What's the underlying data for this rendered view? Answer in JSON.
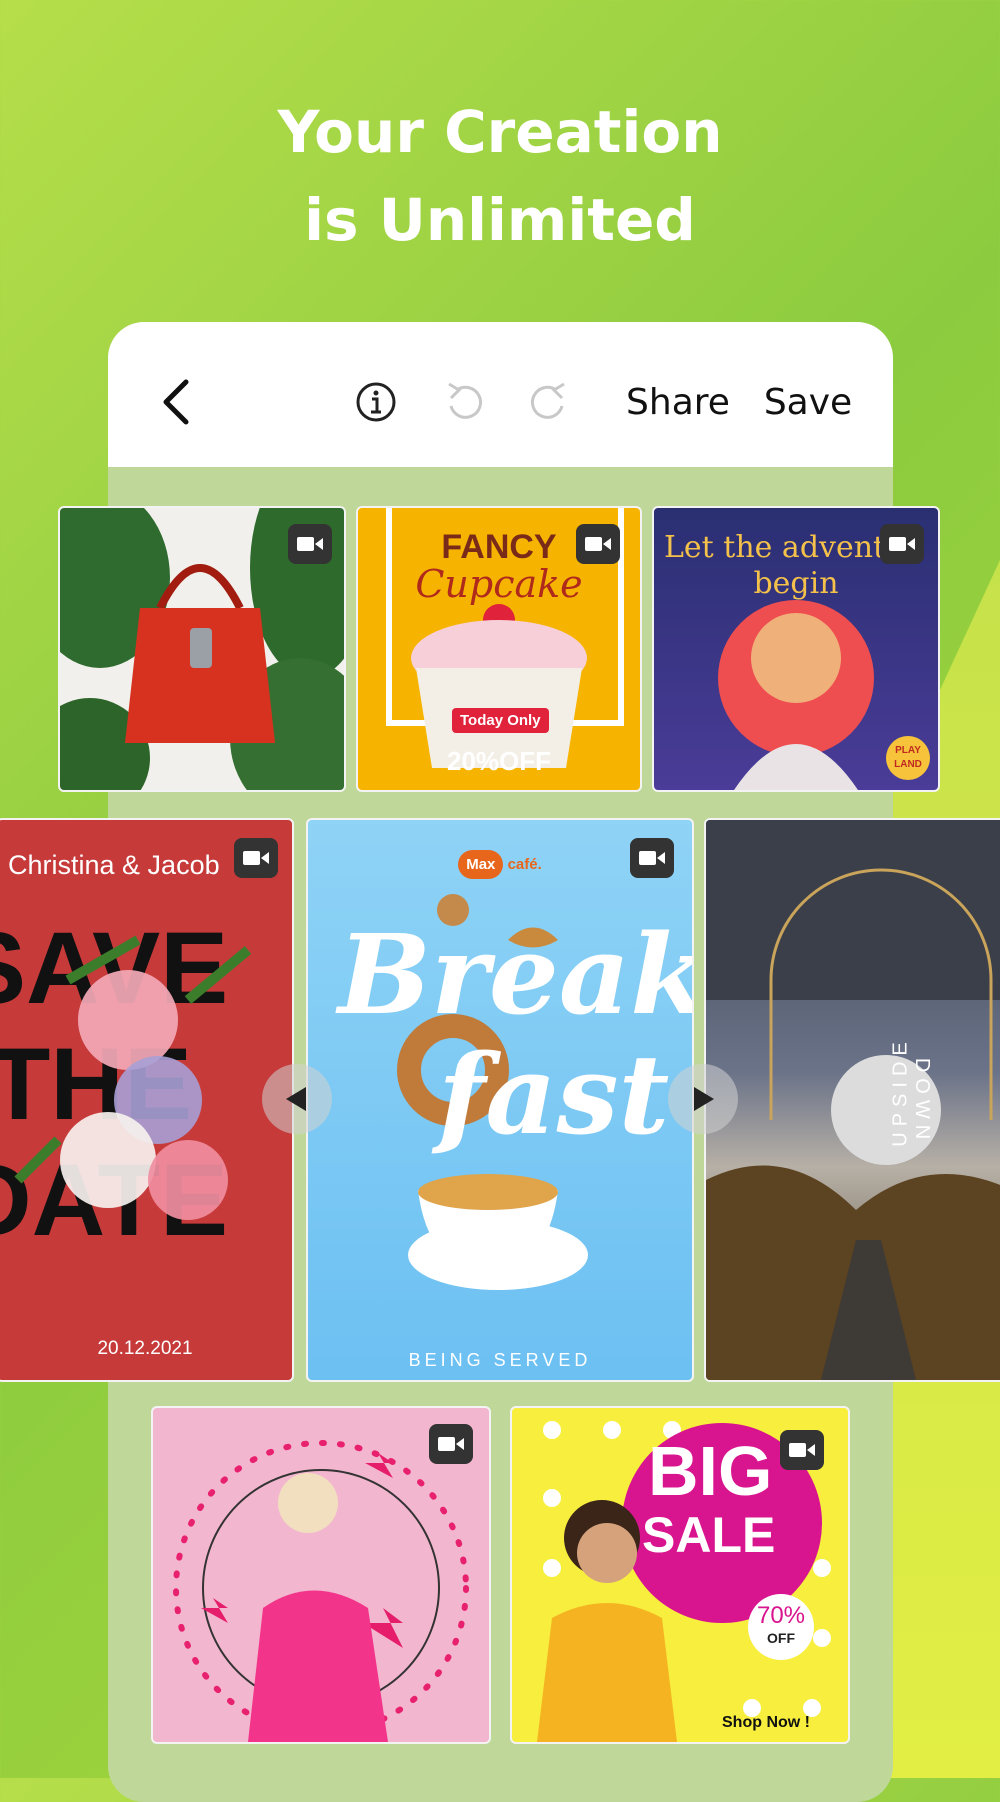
{
  "headline": {
    "line1": "Your Creation",
    "line2": "is Unlimited"
  },
  "toolbar": {
    "share_label": "Share",
    "save_label": "Save"
  },
  "templates": {
    "cupcake": {
      "title": "FANCY",
      "subtitle": "Cupcake",
      "badge": "Today Only",
      "offer": "20%OFF"
    },
    "adventure": {
      "title_line1": "Let the adventur",
      "title_line2": "begin",
      "badge_line1": "PLAY",
      "badge_line2": "LAND"
    },
    "wedding": {
      "names": "Christina & Jacob",
      "line1": "SAVE",
      "line2": "THE",
      "line3": "DATE",
      "date": "20.12.2021"
    },
    "breakfast": {
      "logo_max": "Max",
      "logo_cafe": "café.",
      "word1": "Break",
      "word2": "fast",
      "footer": "BEING SERVED"
    },
    "upside": {
      "word1": "UPSIDE",
      "word2": "DOWN"
    },
    "sale": {
      "line1": "BIG",
      "line2": "SALE",
      "percent": "70%",
      "off": "OFF",
      "cta": "Shop Now !"
    }
  },
  "colors": {
    "accent_green": "#8ccb3f",
    "white": "#ffffff"
  },
  "icons": [
    "chevron-left-icon",
    "info-icon",
    "undo-icon",
    "redo-icon",
    "video-camera-icon",
    "arrow-left-icon",
    "arrow-right-icon"
  ]
}
